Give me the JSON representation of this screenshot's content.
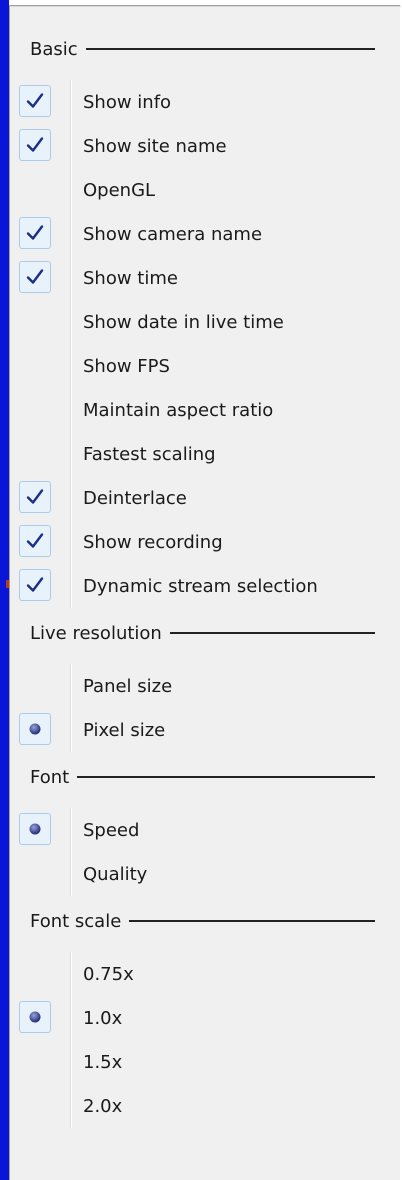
{
  "sections": [
    {
      "title": "Basic",
      "items": [
        {
          "label": "Show info",
          "checked": true,
          "kind": "check"
        },
        {
          "label": "Show site name",
          "checked": true,
          "kind": "check"
        },
        {
          "label": "OpenGL",
          "checked": false,
          "kind": "check"
        },
        {
          "label": "Show camera name",
          "checked": true,
          "kind": "check"
        },
        {
          "label": "Show time",
          "checked": true,
          "kind": "check"
        },
        {
          "label": "Show date in live time",
          "checked": false,
          "kind": "check"
        },
        {
          "label": "Show FPS",
          "checked": false,
          "kind": "check"
        },
        {
          "label": "Maintain aspect ratio",
          "checked": false,
          "kind": "check"
        },
        {
          "label": "Fastest scaling",
          "checked": false,
          "kind": "check"
        },
        {
          "label": "Deinterlace",
          "checked": true,
          "kind": "check"
        },
        {
          "label": "Show recording",
          "checked": true,
          "kind": "check"
        },
        {
          "label": "Dynamic stream selection",
          "checked": true,
          "kind": "check"
        }
      ]
    },
    {
      "title": "Live resolution",
      "items": [
        {
          "label": "Panel size",
          "checked": false,
          "kind": "radio"
        },
        {
          "label": "Pixel size",
          "checked": true,
          "kind": "radio"
        }
      ]
    },
    {
      "title": "Font",
      "items": [
        {
          "label": "Speed",
          "checked": true,
          "kind": "radio"
        },
        {
          "label": "Quality",
          "checked": false,
          "kind": "radio"
        }
      ]
    },
    {
      "title": "Font scale",
      "items": [
        {
          "label": "0.75x",
          "checked": false,
          "kind": "radio"
        },
        {
          "label": "1.0x",
          "checked": true,
          "kind": "radio"
        },
        {
          "label": "1.5x",
          "checked": false,
          "kind": "radio"
        },
        {
          "label": "2.0x",
          "checked": false,
          "kind": "radio"
        }
      ]
    }
  ],
  "icons": {
    "check": "checkmark-icon",
    "radio": "radio-dot-icon"
  },
  "colors": {
    "window_edge": "#0a15d8",
    "menu_bg": "#f0f0f0",
    "check_box_bg": "#e8f2fb",
    "check_box_border": "#a9cbe8",
    "check_mark": "#1a2f8a",
    "text": "#1a1a1a"
  }
}
